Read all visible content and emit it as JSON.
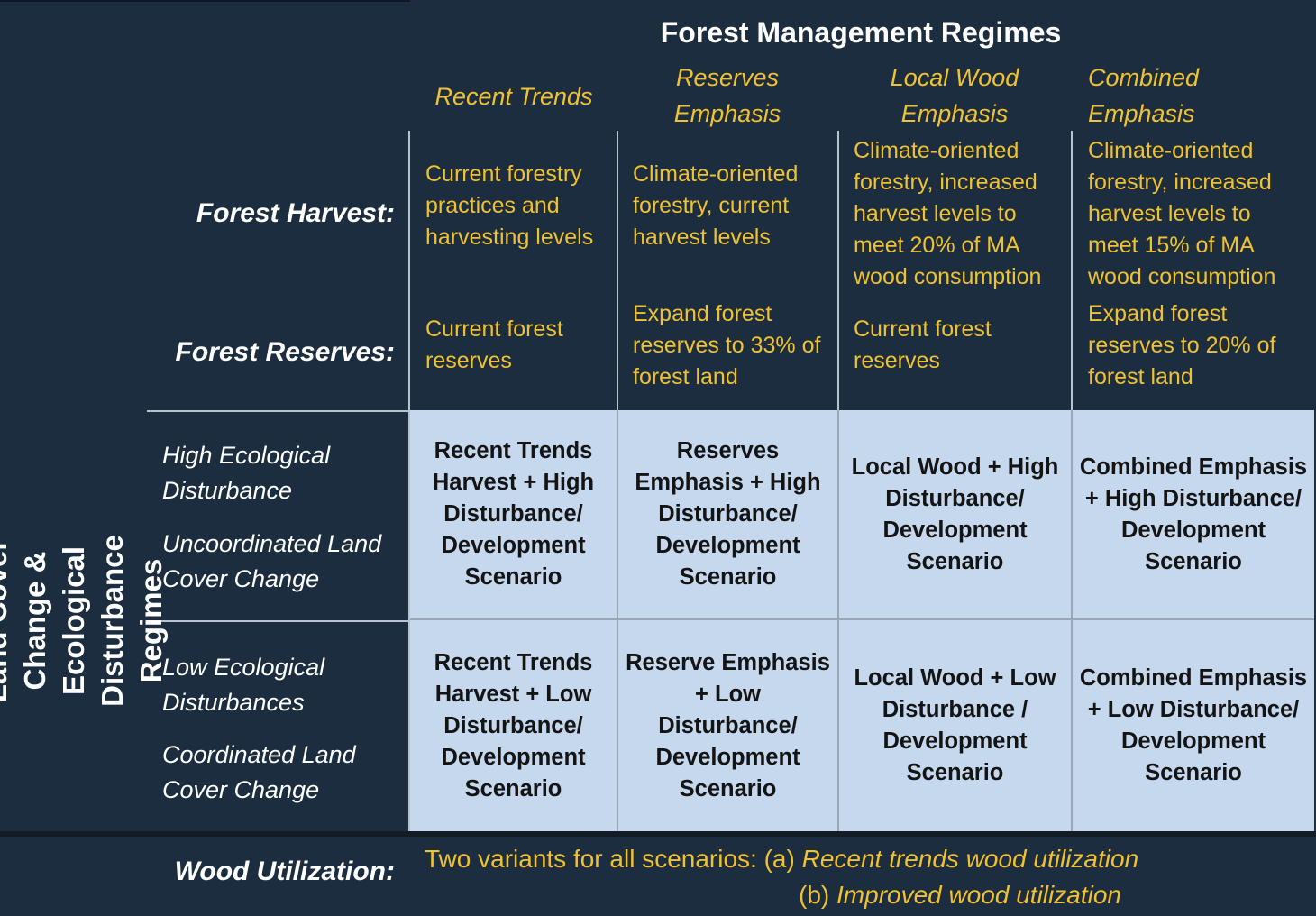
{
  "title": "Forest Management Regimes",
  "regimes": [
    "Recent Trends",
    "Reserves Emphasis",
    "Local Wood Emphasis",
    "Combined Emphasis"
  ],
  "row_labels": {
    "harvest": "Forest Harvest:",
    "reserves": "Forest Reserves:",
    "wood_utilization": "Wood Utilization:"
  },
  "harvest": [
    "Current forestry practices and harvesting levels",
    "Climate-oriented forestry, current harvest levels",
    "Climate-oriented forestry, increased harvest levels to meet 20% of MA wood consumption",
    "Climate-oriented forestry, increased harvest levels to meet 15% of MA wood consumption"
  ],
  "reserves": [
    "Current forest reserves",
    "Expand forest reserves to 33% of forest land",
    "Current forest reserves",
    "Expand forest reserves to 20% of forest land"
  ],
  "side_label": "Land Cover Change & Ecological Disturbance Regimes",
  "disturbance_rows": [
    {
      "line1": "High Ecological Disturbance",
      "line2": "Uncoordinated Land Cover Change"
    },
    {
      "line1": "Low Ecological Disturbances",
      "line2": "Coordinated Land Cover Change"
    }
  ],
  "scenarios": [
    [
      "Recent Trends Harvest + High Disturbance/ Development Scenario",
      "Reserves Emphasis + High Disturbance/ Development Scenario",
      "Local Wood + High Disturbance/ Development Scenario",
      "Combined Emphasis + High Disturbance/ Development Scenario"
    ],
    [
      "Recent Trends Harvest + Low Disturbance/ Development Scenario",
      "Reserve Emphasis + Low Disturbance/ Development Scenario",
      "Local Wood + Low Disturbance / Development Scenario",
      "Combined Emphasis + Low Disturbance/ Development Scenario"
    ]
  ],
  "wood_utilization": {
    "intro": "Two variants for all scenarios: (a)",
    "variant_a": "Recent trends wood utilization",
    "b_marker": "(b)",
    "variant_b": "Improved wood utilization"
  },
  "colors": {
    "background": "#1b2d3e",
    "accent_yellow": "#f0c232",
    "scenario_cell": "#c6d8ee",
    "grid_line": "#b7c3cf"
  }
}
